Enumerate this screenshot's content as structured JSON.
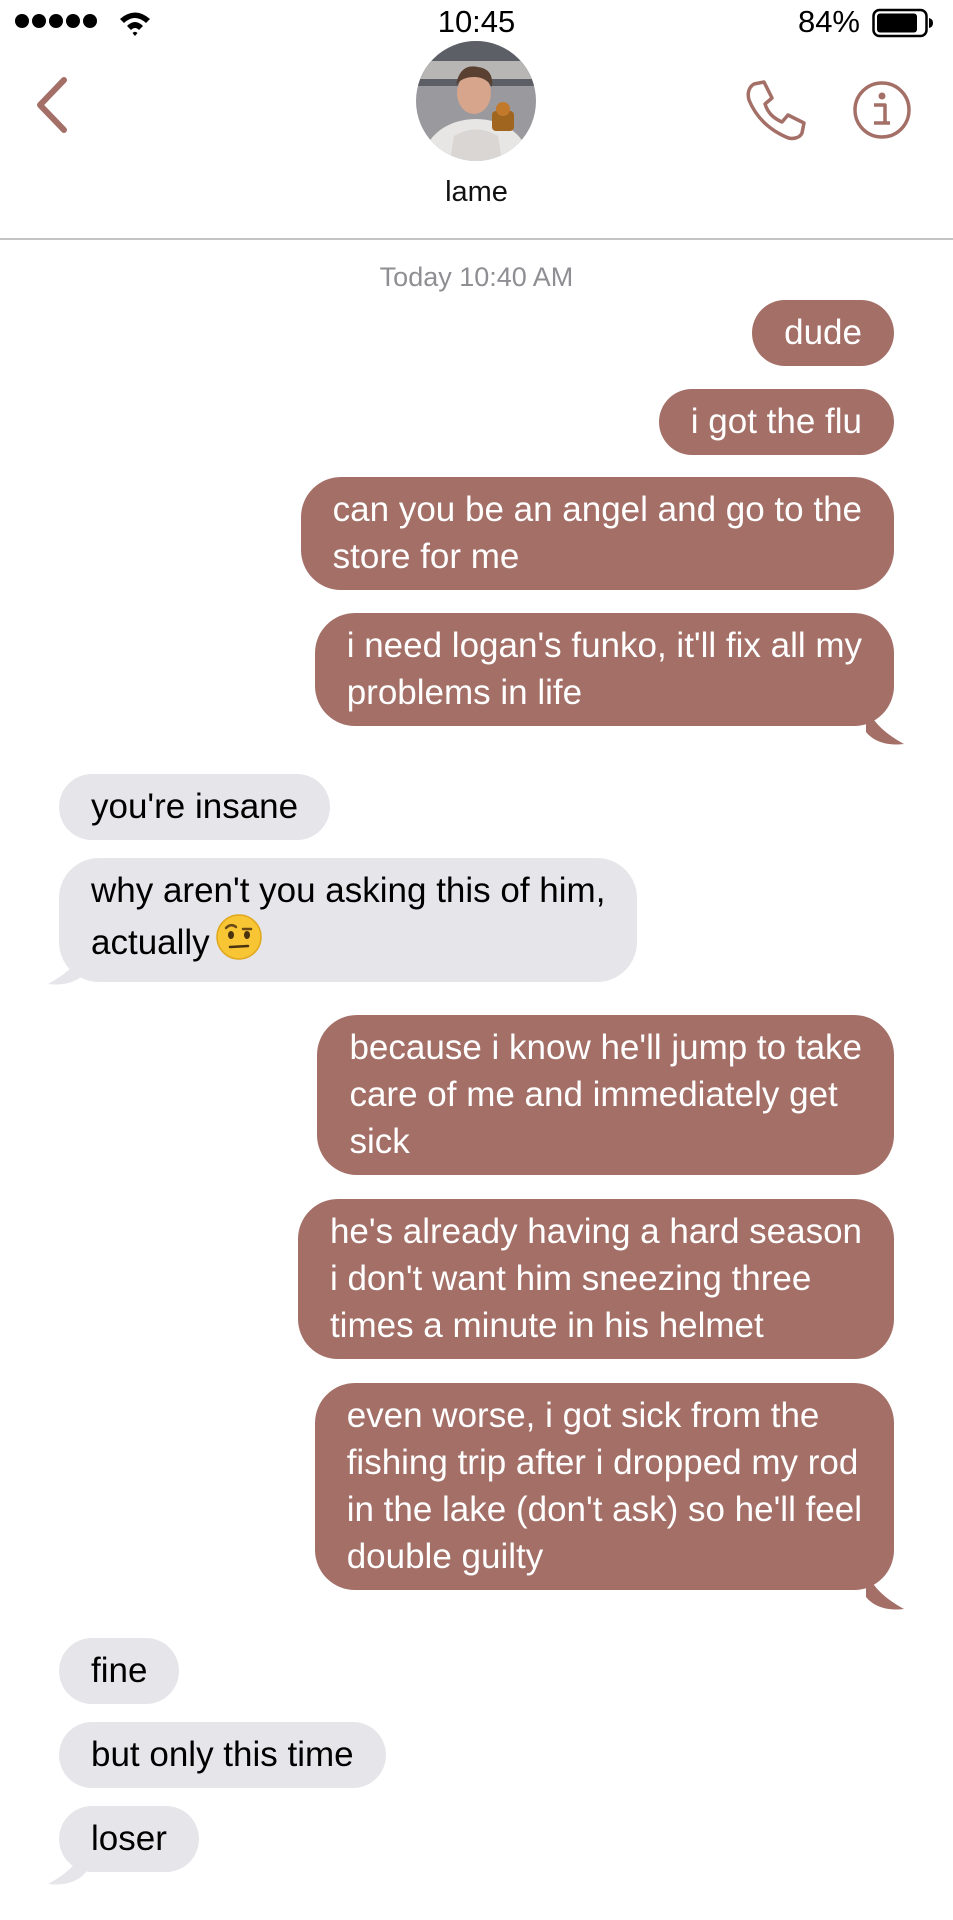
{
  "status_bar": {
    "time": "10:45",
    "battery_percent": "84%",
    "signal_bars": 5,
    "icons": [
      "signal-dots-icon",
      "wifi-icon",
      "battery-icon"
    ]
  },
  "header": {
    "contact_name": "lame",
    "icons": [
      "chevron-left-icon",
      "avatar",
      "phone-icon",
      "info-icon"
    ],
    "accent_color": "#a36f67"
  },
  "conversation": {
    "timestamp": "Today 10:40 AM",
    "sent_color": "#a36f67",
    "received_color": "#e6e5ea",
    "messages": [
      {
        "from": "me",
        "lines": [
          "dude"
        ]
      },
      {
        "from": "me",
        "lines": [
          "i got the flu"
        ]
      },
      {
        "from": "me",
        "lines": [
          "can you be an angel and go to the",
          "store for me"
        ]
      },
      {
        "from": "me",
        "lines": [
          "i need logan's funko, it'll fix all my",
          "problems in life"
        ]
      },
      {
        "from": "them",
        "lines": [
          "you're insane"
        ]
      },
      {
        "from": "them",
        "lines": [
          "why aren't you asking this of him,",
          "actually"
        ],
        "emoji": "raised-eyebrow-face-icon"
      },
      {
        "from": "me",
        "lines": [
          "because i know he'll jump to take",
          "care of me and immediately get",
          "sick"
        ]
      },
      {
        "from": "me",
        "lines": [
          "he's already having a hard season",
          "i don't want him sneezing three",
          "times a minute in his helmet"
        ]
      },
      {
        "from": "me",
        "lines": [
          "even worse, i got sick from the",
          "fishing trip after i dropped my rod",
          "in the lake (don't ask) so he'll feel",
          "double guilty"
        ]
      },
      {
        "from": "them",
        "lines": [
          "fine"
        ]
      },
      {
        "from": "them",
        "lines": [
          "but only this time"
        ]
      },
      {
        "from": "them",
        "lines": [
          "loser"
        ]
      }
    ]
  }
}
